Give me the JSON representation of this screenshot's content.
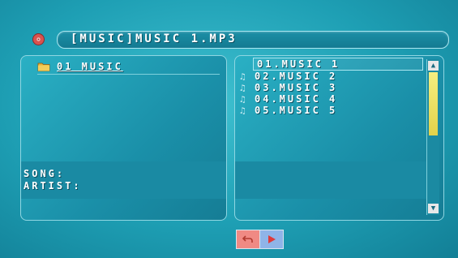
{
  "header": {
    "title": "[MUSIC]MUSIC 1.MP3",
    "icon": "disc-icon"
  },
  "left_panel": {
    "folder": {
      "label": "01 MUSIC",
      "icon": "folder-icon"
    },
    "info": {
      "song_label": "SONG:",
      "artist_label": "ARTIST:"
    }
  },
  "file_list": {
    "items": [
      {
        "label": "01.MUSIC 1",
        "selected": true
      },
      {
        "label": "02.MUSIC 2",
        "icon": "note-icon"
      },
      {
        "label": "03.MUSIC 3",
        "icon": "note-icon"
      },
      {
        "label": "04.MUSIC 4",
        "icon": "note-icon"
      },
      {
        "label": "05.MUSIC 5",
        "icon": "note-icon"
      }
    ],
    "scroll_up_icon": "triangle-up-icon",
    "scroll_down_icon": "triangle-down-icon"
  },
  "controls": {
    "return_icon": "return-icon",
    "play_icon": "play-icon"
  },
  "colors": {
    "background": "#1e9fb4",
    "scroll_thumb": "#e2d24a",
    "return_button": "#f08a84",
    "play_button": "#8fb4e8"
  }
}
